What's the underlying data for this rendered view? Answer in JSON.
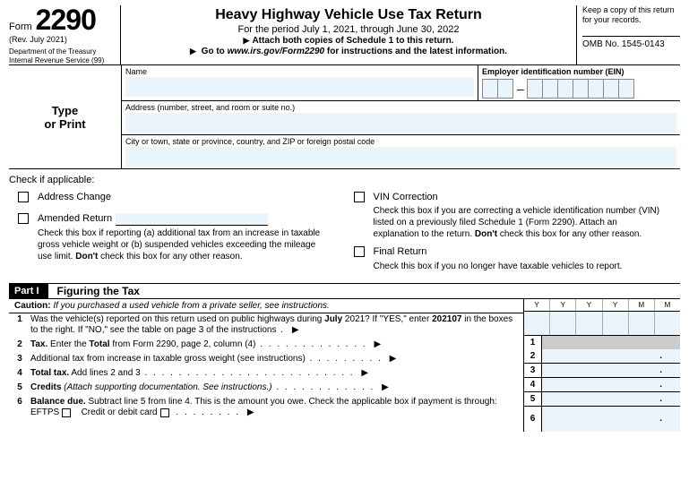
{
  "header": {
    "form_word": "Form",
    "form_number": "2290",
    "revision": "(Rev. July 2021)",
    "department": "Department of the Treasury\nInternal Revenue Service (99)",
    "title": "Heavy Highway Vehicle Use Tax Return",
    "period": "For the period July 1, 2021, through June 30, 2022",
    "attach": "Attach both copies of Schedule 1 to this return.",
    "goto_pre": "Go to ",
    "goto_url": "www.irs.gov/Form2290",
    "goto_post": " for instructions and the latest information.",
    "keep_copy": "Keep a copy of this return for your records.",
    "omb": "OMB No. 1545-0143"
  },
  "info": {
    "type_or_print": "Type\nor Print",
    "name_label": "Name",
    "ein_label": "Employer identification number (EIN)",
    "address_label": "Address (number, street, and room or suite no.)",
    "city_label": "City or town, state or province, country, and ZIP or foreign postal code"
  },
  "checks": {
    "header": "Check if applicable:",
    "address_change": "Address Change",
    "amended_return": "Amended Return",
    "amended_desc_a": "Check this box if reporting (a) additional tax from an increase in taxable gross vehicle weight or (b) suspended vehicles exceeding the mileage use limit. ",
    "amended_dont": "Don't",
    "amended_desc_b": " check this box for any other reason.",
    "vin_correction": "VIN Correction",
    "vin_desc_a": "Check this box if you are correcting a vehicle identification number (VIN) listed on a previously filed Schedule 1 (Form 2290). Attach an explanation to the return. ",
    "vin_dont": "Don't",
    "vin_desc_b": " check this box for any other reason.",
    "final_return": "Final Return",
    "final_desc": "Check this box if you no longer have taxable vehicles to report."
  },
  "part1": {
    "tag": "Part I",
    "title": "Figuring the Tax",
    "caution_label": "Caution:",
    "caution_text": " If you purchased a used vehicle from a private seller, see instructions.",
    "ymmm": [
      "Y",
      "Y",
      "Y",
      "Y",
      "M",
      "M"
    ],
    "lines": {
      "l1": {
        "num": "1",
        "text_a": "Was the vehicle(s) reported on this return used on public highways during ",
        "text_b": "July",
        "text_c": " 2021? If \"YES,\" enter ",
        "text_d": "202107",
        "text_e": " in the boxes to the right. If \"NO,\" see the table on page 3 of the instructions",
        "box": "1"
      },
      "l2": {
        "num": "2",
        "text_a": "Tax.",
        "text_b": " Enter the ",
        "text_c": "Total",
        "text_d": " from Form 2290, page 2, column (4)",
        "box": "2"
      },
      "l3": {
        "num": "3",
        "text": "Additional tax from increase in taxable gross weight (see instructions)",
        "box": "3"
      },
      "l4": {
        "num": "4",
        "text_a": "Total tax.",
        "text_b": " Add lines 2 and 3",
        "box": "4"
      },
      "l5": {
        "num": "5",
        "text_a": "Credits ",
        "text_b": "(Attach supporting documentation. See instructions.)",
        "box": "5"
      },
      "l6": {
        "num": "6",
        "text_a": "Balance due.",
        "text_b": " Subtract line 5 from line 4. This is the amount you owe. Check the applicable box if payment is through:    EFTPS",
        "text_c": "Credit or debit card",
        "box": "6"
      }
    }
  }
}
